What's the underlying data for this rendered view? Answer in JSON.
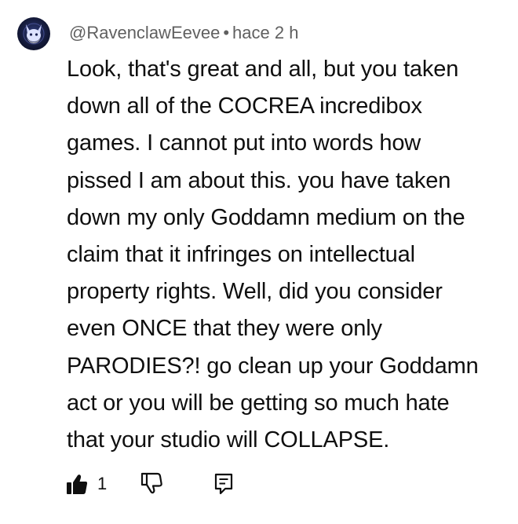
{
  "comment": {
    "author": "@RavenclawEevee",
    "separator": "•",
    "time": "hace 2 h",
    "avatar_icon": "eevee-avatar-icon",
    "text_lines": [
      "Look, that's great and all, but you taken",
      "down all of the COCREA incredibox",
      "games. I cannot put into words how",
      "pissed I am about this. you have taken",
      "down my only Goddamn medium on the",
      "claim that it infringes on intellectual",
      "property rights. Well, did you consider",
      "even ONCE that they were only",
      "PARODIES?! go clean up your Goddamn",
      "act or you will be getting so much hate",
      "that your studio will COLLAPSE."
    ],
    "actions": {
      "like_icon": "thumbs-up-filled-icon",
      "like_count": "1",
      "dislike_icon": "thumbs-down-icon",
      "reply_icon": "reply-comment-icon"
    }
  },
  "colors": {
    "text": "#0f0f0f",
    "meta": "#606060",
    "background": "#ffffff"
  }
}
